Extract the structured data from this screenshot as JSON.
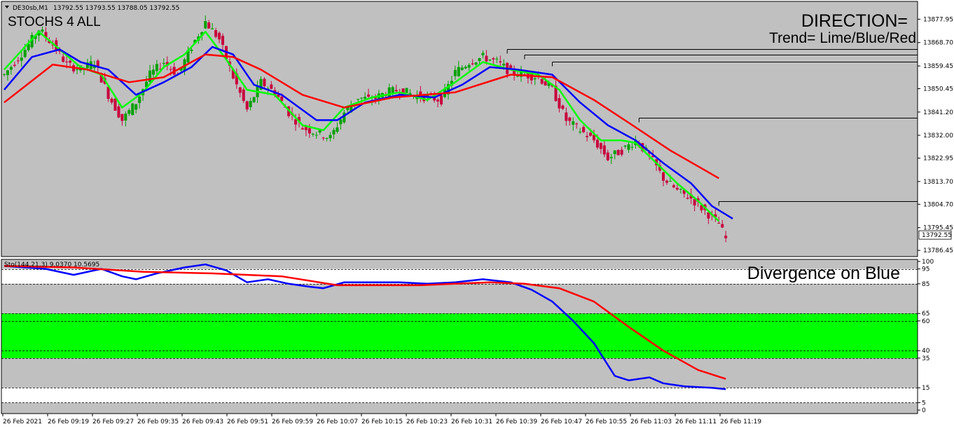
{
  "window": {
    "title": "DE30sb,M1",
    "ohlc": "13792.55 13793.55 13788.05 13792.55",
    "indicator_label": "Sto(144,21,3) 9.0370 10.5695"
  },
  "annotations": {
    "name": "STOCHS 4 ALL",
    "direction": "DIRECTION=",
    "trend": "Trend= Lime/Blue/Red",
    "divergence": "Divergence on Blue"
  },
  "colors": {
    "background": "#c0c0c0",
    "bull_candle": "#00a000",
    "bear_candle": "#c8003c",
    "lime": "#00ff00",
    "blue": "#0000ff",
    "red": "#ff0000",
    "zone": "#00ff00",
    "white_zone": "#ffffff"
  },
  "chart_data": [
    {
      "type": "candlestick",
      "timeframe": "M1",
      "symbol": "DE30sb",
      "y_ticks": [
        "13877.95",
        "13868.70",
        "13859.45",
        "13850.45",
        "13841.20",
        "13832.00",
        "13822.95",
        "13813.70",
        "13804.70",
        "13795.45",
        "13786.45"
      ],
      "ylim": [
        13784.0,
        13885.0
      ],
      "current_price": "13792.55",
      "price_points": [
        [
          0,
          13856
        ],
        [
          6,
          13866
        ],
        [
          10,
          13874
        ],
        [
          14,
          13868
        ],
        [
          18,
          13860
        ],
        [
          22,
          13858
        ],
        [
          26,
          13861
        ],
        [
          30,
          13848
        ],
        [
          34,
          13838
        ],
        [
          38,
          13845
        ],
        [
          42,
          13856
        ],
        [
          46,
          13861
        ],
        [
          50,
          13856
        ],
        [
          54,
          13867
        ],
        [
          58,
          13877
        ],
        [
          62,
          13870
        ],
        [
          66,
          13855
        ],
        [
          70,
          13842
        ],
        [
          74,
          13853
        ],
        [
          78,
          13849
        ],
        [
          82,
          13841
        ],
        [
          86,
          13835
        ],
        [
          90,
          13833
        ],
        [
          94,
          13831
        ],
        [
          98,
          13841
        ],
        [
          102,
          13847
        ],
        [
          106,
          13846
        ],
        [
          110,
          13849
        ],
        [
          114,
          13850
        ],
        [
          118,
          13848
        ],
        [
          122,
          13847
        ],
        [
          126,
          13846
        ],
        [
          130,
          13857
        ],
        [
          134,
          13861
        ],
        [
          138,
          13863
        ],
        [
          142,
          13861
        ],
        [
          146,
          13857
        ],
        [
          150,
          13856
        ],
        [
          154,
          13855
        ],
        [
          158,
          13850
        ],
        [
          162,
          13838
        ],
        [
          166,
          13834
        ],
        [
          170,
          13830
        ],
        [
          174,
          13823
        ],
        [
          178,
          13826
        ],
        [
          182,
          13830
        ],
        [
          186,
          13824
        ],
        [
          190,
          13815
        ],
        [
          194,
          13810
        ],
        [
          198,
          13807
        ],
        [
          202,
          13802
        ],
        [
          206,
          13797
        ],
        [
          208,
          13791
        ]
      ],
      "series": [
        {
          "name": "Lime",
          "values": [
            [
              0,
              13858
            ],
            [
              10,
              13873
            ],
            [
              16,
              13866
            ],
            [
              22,
              13859
            ],
            [
              28,
              13856
            ],
            [
              34,
              13843
            ],
            [
              40,
              13849
            ],
            [
              46,
              13859
            ],
            [
              52,
              13864
            ],
            [
              58,
              13873
            ],
            [
              64,
              13862
            ],
            [
              70,
              13850
            ],
            [
              78,
              13848
            ],
            [
              86,
              13836
            ],
            [
              92,
              13834
            ],
            [
              98,
              13843
            ],
            [
              106,
              13847
            ],
            [
              114,
              13849
            ],
            [
              122,
              13846
            ],
            [
              130,
              13853
            ],
            [
              138,
              13861
            ],
            [
              146,
              13858
            ],
            [
              154,
              13856
            ],
            [
              160,
              13850
            ],
            [
              166,
              13838
            ],
            [
              172,
              13830
            ],
            [
              178,
              13830
            ],
            [
              182,
              13829
            ],
            [
              188,
              13821
            ],
            [
              194,
              13813
            ],
            [
              200,
              13806
            ],
            [
              206,
              13798
            ]
          ]
        },
        {
          "name": "Blue",
          "values": [
            [
              0,
              13850
            ],
            [
              8,
              13863
            ],
            [
              16,
              13866
            ],
            [
              22,
              13861
            ],
            [
              30,
              13858
            ],
            [
              38,
              13848
            ],
            [
              46,
              13853
            ],
            [
              54,
              13859
            ],
            [
              60,
              13867
            ],
            [
              66,
              13864
            ],
            [
              72,
              13852
            ],
            [
              80,
              13848
            ],
            [
              90,
              13838
            ],
            [
              96,
              13838
            ],
            [
              104,
              13845
            ],
            [
              114,
              13848
            ],
            [
              124,
              13847
            ],
            [
              132,
              13852
            ],
            [
              140,
              13859
            ],
            [
              148,
              13858
            ],
            [
              158,
              13856
            ],
            [
              166,
              13845
            ],
            [
              174,
              13836
            ],
            [
              182,
              13830
            ],
            [
              190,
              13821
            ],
            [
              198,
              13813
            ],
            [
              204,
              13804
            ],
            [
              210,
              13799
            ]
          ]
        },
        {
          "name": "Red",
          "values": [
            [
              0,
              13845
            ],
            [
              14,
              13860
            ],
            [
              24,
              13858
            ],
            [
              36,
              13853
            ],
            [
              46,
              13855
            ],
            [
              58,
              13864
            ],
            [
              66,
              13863
            ],
            [
              74,
              13858
            ],
            [
              86,
              13848
            ],
            [
              98,
              13843
            ],
            [
              112,
              13847
            ],
            [
              130,
              13849
            ],
            [
              146,
              13856
            ],
            [
              158,
              13855
            ],
            [
              170,
              13846
            ],
            [
              180,
              13837
            ],
            [
              192,
              13826
            ],
            [
              206,
              13815
            ]
          ]
        }
      ],
      "horizontal_levels": [
        [
          145,
          13866
        ],
        [
          150,
          13864
        ],
        [
          158,
          13861
        ],
        [
          183,
          13839
        ],
        [
          206,
          13806
        ]
      ],
      "x_tick_labels": [
        "26 Feb 2021",
        "26 Feb 09:19",
        "26 Feb 09:27",
        "26 Feb 09:35",
        "26 Feb 09:43",
        "26 Feb 09:51",
        "26 Feb 09:59",
        "26 Feb 10:07",
        "26 Feb 10:15",
        "26 Feb 10:23",
        "26 Feb 10:31",
        "26 Feb 10:39",
        "26 Feb 10:47",
        "26 Feb 10:55",
        "26 Feb 11:03",
        "26 Feb 11:11",
        "26 Feb 11:19"
      ]
    },
    {
      "type": "line",
      "indicator": "Stochastic",
      "ylim": [
        0,
        100
      ],
      "levels": [
        95,
        85,
        65,
        60,
        40,
        35,
        15,
        5
      ],
      "y_ticks": [
        "100",
        "95",
        "85",
        "65",
        "60",
        "40",
        "35",
        "15",
        "5",
        "0"
      ],
      "zones": [
        [
          35,
          65
        ],
        [
          85,
          95
        ],
        [
          5,
          15
        ]
      ],
      "series": [
        {
          "name": "Blue",
          "values": [
            [
              0,
              97
            ],
            [
              6,
              96
            ],
            [
              12,
              95
            ],
            [
              20,
              91
            ],
            [
              28,
              95
            ],
            [
              34,
              90
            ],
            [
              38,
              88
            ],
            [
              44,
              92
            ],
            [
              52,
              96
            ],
            [
              58,
              98
            ],
            [
              64,
              94
            ],
            [
              70,
              86
            ],
            [
              76,
              88
            ],
            [
              82,
              85
            ],
            [
              88,
              83
            ],
            [
              92,
              82
            ],
            [
              98,
              86
            ],
            [
              106,
              86
            ],
            [
              114,
              86
            ],
            [
              122,
              85
            ],
            [
              130,
              86
            ],
            [
              138,
              88
            ],
            [
              146,
              86
            ],
            [
              152,
              81
            ],
            [
              158,
              73
            ],
            [
              164,
              60
            ],
            [
              170,
              45
            ],
            [
              176,
              23
            ],
            [
              180,
              20
            ],
            [
              186,
              22
            ],
            [
              190,
              18
            ],
            [
              196,
              16
            ],
            [
              204,
              15
            ],
            [
              208,
              14
            ]
          ]
        },
        {
          "name": "Red",
          "values": [
            [
              0,
              97
            ],
            [
              20,
              96
            ],
            [
              40,
              93
            ],
            [
              60,
              92
            ],
            [
              80,
              90
            ],
            [
              96,
              84
            ],
            [
              120,
              84
            ],
            [
              140,
              86
            ],
            [
              150,
              85
            ],
            [
              160,
              82
            ],
            [
              170,
              73
            ],
            [
              180,
              56
            ],
            [
              190,
              40
            ],
            [
              200,
              27
            ],
            [
              208,
              21
            ]
          ]
        }
      ]
    }
  ]
}
